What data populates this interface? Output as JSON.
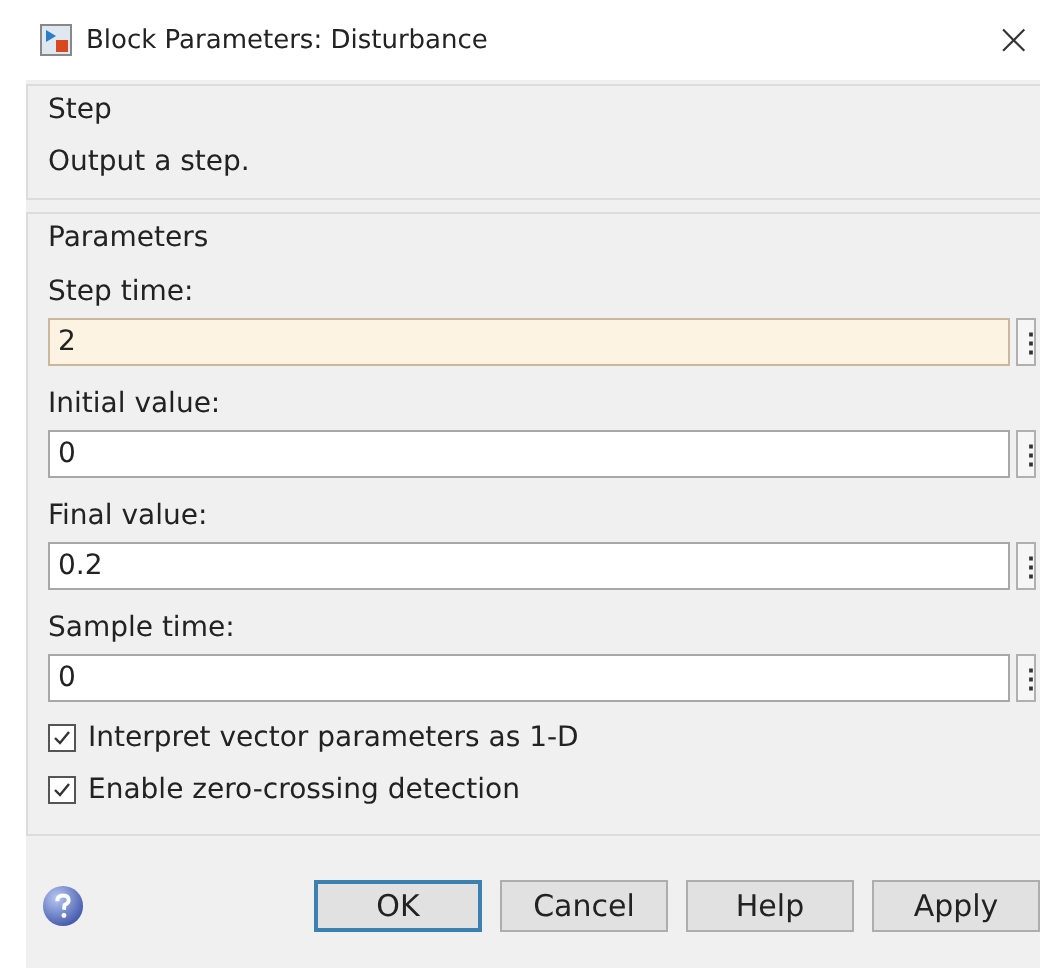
{
  "window": {
    "title": "Block Parameters: Disturbance",
    "close": "×"
  },
  "description_group": {
    "title": "Step",
    "text": "Output a step."
  },
  "parameters_group": {
    "title": "Parameters",
    "fields": [
      {
        "label": "Step time:",
        "value": "2",
        "focused": true,
        "menu": "⋮"
      },
      {
        "label": "Initial value:",
        "value": "0",
        "focused": false,
        "menu": "⋮"
      },
      {
        "label": "Final value:",
        "value": "0.2",
        "focused": false,
        "menu": "⋮"
      },
      {
        "label": "Sample time:",
        "value": "0",
        "focused": false,
        "menu": "⋮"
      }
    ],
    "checkboxes": [
      {
        "label": "Interpret vector parameters as 1-D",
        "checked": true
      },
      {
        "label": "Enable zero-crossing detection",
        "checked": true
      }
    ]
  },
  "buttons": [
    {
      "label": "OK",
      "default": true
    },
    {
      "label": "Cancel",
      "default": false
    },
    {
      "label": "Help",
      "default": false
    },
    {
      "label": "Apply",
      "default": false
    }
  ]
}
